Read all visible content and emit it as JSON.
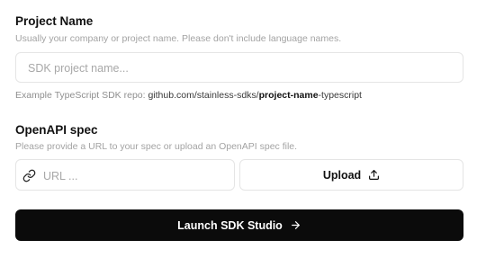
{
  "project": {
    "label": "Project Name",
    "help": "Usually your company or project name. Please don't include language names.",
    "input_placeholder": "SDK project name...",
    "example_prefix": "Example TypeScript SDK repo:",
    "example_repo_prefix": "github.com/stainless-sdks/",
    "example_repo_bold": "project-name",
    "example_repo_suffix": "-typescript"
  },
  "openapi": {
    "label": "OpenAPI spec",
    "help": "Please provide a URL to your spec or upload an OpenAPI spec file.",
    "url_placeholder": "URL ...",
    "upload_label": "Upload"
  },
  "launch": {
    "label": "Launch SDK Studio"
  },
  "icons": {
    "url": "link-icon",
    "upload": "upload-icon",
    "launch": "arrow-right-icon"
  },
  "colors": {
    "primary_button": "#0b0b0b",
    "border": "#e5e5e5"
  }
}
